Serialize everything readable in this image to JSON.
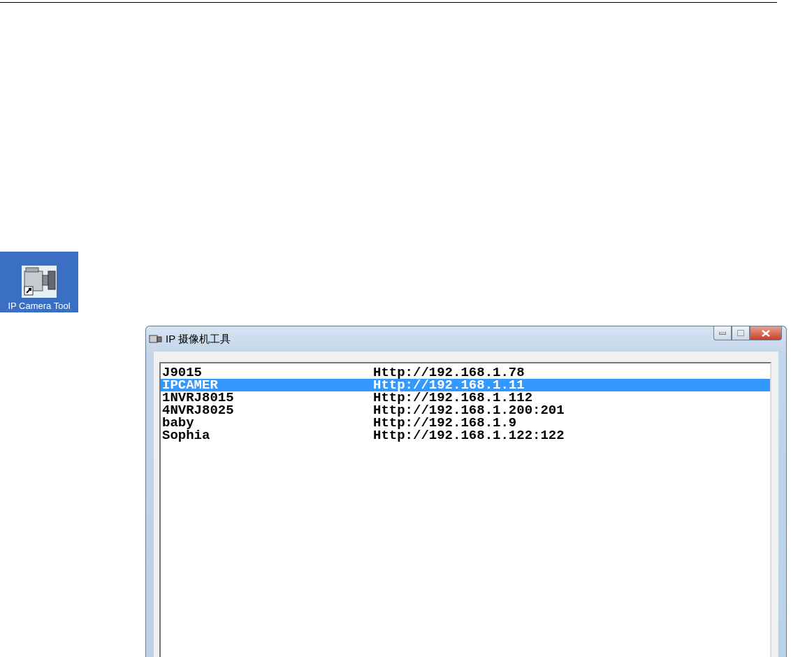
{
  "desktop_icon": {
    "label": "IP Camera Tool"
  },
  "window": {
    "title": "IP 摄像机工具"
  },
  "devices": [
    {
      "name": "J9015",
      "url": "Http://192.168.1.78",
      "selected": false
    },
    {
      "name": "IPCAMER",
      "url": "Http://192.168.1.11",
      "selected": true
    },
    {
      "name": "1NVRJ8015",
      "url": "Http://192.168.1.112",
      "selected": false
    },
    {
      "name": "4NVRJ8025",
      "url": "Http://192.168.1.200:201",
      "selected": false
    },
    {
      "name": "baby",
      "url": "Http://192.168.1.9",
      "selected": false
    },
    {
      "name": "Sophia",
      "url": "Http://192.168.1.122:122",
      "selected": false
    }
  ]
}
